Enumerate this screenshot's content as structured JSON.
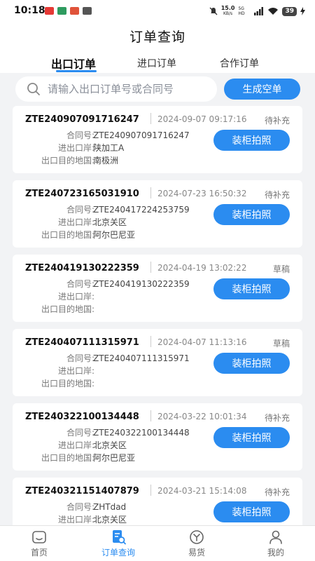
{
  "status_bar": {
    "time": "10:18",
    "net_speed": "15.0",
    "net_unit": "KB/s",
    "signal": "5G HD",
    "battery": "39",
    "icons": [
      "notification-app-icon",
      "notification-app-icon",
      "notification-app-icon",
      "mail-icon"
    ]
  },
  "header": {
    "title": "订单查询"
  },
  "tabs": [
    {
      "label": "出口订单",
      "active": true
    },
    {
      "label": "进口订单",
      "active": false
    },
    {
      "label": "合作订单",
      "active": false
    }
  ],
  "search": {
    "placeholder": "请输入出口订单号或合同号",
    "value": ""
  },
  "create_button": {
    "label": "生成空单"
  },
  "field_labels": {
    "contract": "合同号:",
    "port": "进出口岸:",
    "destination": "出口目的地国:"
  },
  "orders": [
    {
      "id": "ZTE240907091716247",
      "time": "2024-09-07 09:17:16",
      "status": "待补充",
      "contract": "ZTE240907091716247",
      "port": "陕加工A",
      "destination": "南极洲",
      "action": "装柜拍照"
    },
    {
      "id": "ZTE240723165031910",
      "time": "2024-07-23 16:50:32",
      "status": "待补充",
      "contract": "ZTE240417224253759",
      "port": "北京关区",
      "destination": "阿尔巴尼亚",
      "action": "装柜拍照"
    },
    {
      "id": "ZTE240419130222359",
      "time": "2024-04-19 13:02:22",
      "status": "草稿",
      "contract": "ZTE240419130222359",
      "port": "",
      "destination": "",
      "action": "装柜拍照"
    },
    {
      "id": "ZTE240407111315971",
      "time": "2024-04-07 11:13:16",
      "status": "草稿",
      "contract": "ZTE240407111315971",
      "port": "",
      "destination": "",
      "action": "装柜拍照"
    },
    {
      "id": "ZTE240322100134448",
      "time": "2024-03-22 10:01:34",
      "status": "待补充",
      "contract": "ZTE240322100134448",
      "port": "北京关区",
      "destination": "阿尔巴尼亚",
      "action": "装柜拍照"
    },
    {
      "id": "ZTE240321151407879",
      "time": "2024-03-21 15:14:08",
      "status": "待补充",
      "contract": "ZHTdad",
      "port": "北京关区",
      "destination": "",
      "action": "装柜拍照"
    }
  ],
  "bottom_nav": [
    {
      "label": "首页",
      "icon": "home-icon",
      "active": false
    },
    {
      "label": "订单查询",
      "icon": "order-search-icon",
      "active": true
    },
    {
      "label": "易货",
      "icon": "barter-icon",
      "active": false
    },
    {
      "label": "我的",
      "icon": "profile-icon",
      "active": false
    }
  ],
  "colors": {
    "accent": "#2b8cf0",
    "background": "#f2f3f5",
    "card": "#ffffff"
  }
}
